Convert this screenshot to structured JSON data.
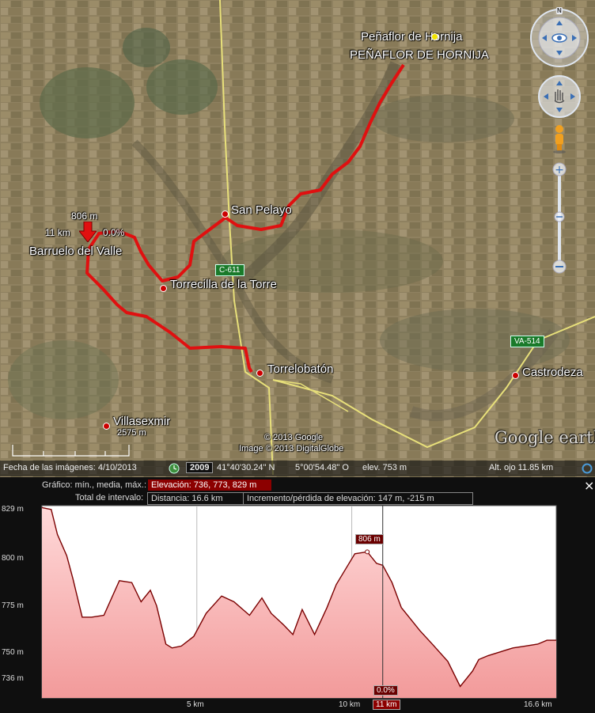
{
  "map": {
    "places": [
      {
        "name": "Peñaflor de Hornija",
        "key": "penaflor"
      },
      {
        "name": "PEÑAFLOR DE HORNIJA",
        "key": "penaflor_caps"
      },
      {
        "name": "San Pelayo",
        "key": "san_pelayo"
      },
      {
        "name": "Barruelo del Valle",
        "key": "barruelo"
      },
      {
        "name": "Torrecilla de la Torre",
        "key": "torrecilla"
      },
      {
        "name": "Torrelobatón",
        "key": "torrelobaton"
      },
      {
        "name": "Castrodeza",
        "key": "castrodeza"
      },
      {
        "name": "Villasexmir",
        "key": "villasexmir"
      }
    ],
    "roads": [
      "C-611",
      "VA-514"
    ],
    "start_marker": {
      "elevation": "806 m",
      "distance": "11 km",
      "slope": "0.0%"
    },
    "scale_label": "2575 m",
    "copyright1": "© 2013 Google",
    "copyright2": "Image © 2013 DigitalGlobe",
    "logo": "Google earth",
    "compass_north": "N"
  },
  "status": {
    "imagery_date": "Fecha de las imágenes: 4/10/2013",
    "year": "2009",
    "lat": "41°40'30.24\" N",
    "lon": "5°00'54.48\" O",
    "elev": "elev.   753 m",
    "eye_alt": "Alt. ojo   11.85 km"
  },
  "profile": {
    "close": "×",
    "graph_label": "Gráfico: mín., media, máx.:",
    "elevation_stats": "Elevación: 736, 773, 829 m",
    "range_label": "Total de intervalo:",
    "distance": "Distancia: 16.6 km",
    "gain_loss": "Incremento/pérdida de elevación: 147 m, -215 m",
    "y_ticks": [
      "829 m",
      "800 m",
      "775 m",
      "750 m",
      "736 m"
    ],
    "x_ticks": [
      "5 km",
      "10 km",
      "16.6 km"
    ],
    "cursor_elevation": "806 m",
    "cursor_slope": "0.0%",
    "cursor_distance": "11 km"
  },
  "chart_data": {
    "type": "area",
    "xlabel": "",
    "ylabel": "",
    "xlim": [
      0,
      16.6
    ],
    "ylim": [
      730,
      830
    ],
    "x": [
      0,
      0.3,
      0.5,
      0.8,
      1.0,
      1.3,
      1.6,
      2.0,
      2.5,
      2.9,
      3.2,
      3.5,
      3.7,
      4.0,
      4.2,
      4.5,
      4.9,
      5.3,
      5.8,
      6.2,
      6.7,
      7.1,
      7.4,
      7.8,
      8.1,
      8.4,
      8.8,
      9.2,
      9.5,
      9.8,
      10.1,
      10.5,
      10.8,
      11.0,
      11.3,
      11.6,
      11.9,
      12.2,
      12.6,
      13.1,
      13.5,
      13.9,
      14.1,
      14.4,
      14.8,
      15.2,
      15.6,
      16.0,
      16.3,
      16.6
    ],
    "y": [
      829,
      828,
      815,
      804,
      792,
      772,
      772,
      773,
      791,
      790,
      780,
      786,
      778,
      758,
      756,
      757,
      762,
      774,
      783,
      780,
      773,
      782,
      774,
      768,
      763,
      776,
      763,
      777,
      789,
      797,
      805,
      806,
      800,
      799,
      790,
      777,
      771,
      765,
      758,
      749,
      736,
      744,
      750,
      752,
      754,
      756,
      757,
      758,
      760,
      760
    ],
    "grid": true
  }
}
